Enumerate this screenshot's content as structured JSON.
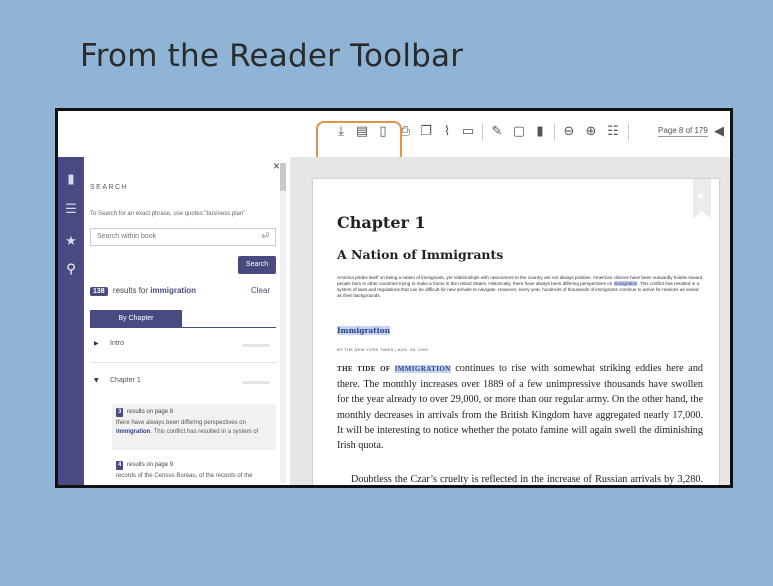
{
  "slide": {
    "title": "From the Reader Toolbar"
  },
  "toolbar": {
    "page_indicator": "Page 8 of 179",
    "icons": [
      "download-icon",
      "print-section-icon",
      "bookmark-outline-icon",
      "print-icon",
      "copy-icon",
      "link-icon",
      "comment-icon",
      "highlight-pen-icon",
      "note-icon",
      "bookmark-icon",
      "zoom-out-icon",
      "zoom-in-icon",
      "view-settings-icon",
      "previous-page-icon"
    ]
  },
  "rail": {
    "icons": [
      "book-icon",
      "table-of-contents-icon",
      "favorites-star-icon",
      "search-icon"
    ]
  },
  "search": {
    "close": "×",
    "heading": "SEARCH",
    "hint": "To Search for an exact phrase, use quotes:\"business plan\"",
    "placeholder": "Search within book",
    "enter_icon": "⏎",
    "search_button": "Search",
    "results_count": "138",
    "results_text": "results for",
    "results_term": "immigration",
    "clear": "Clear",
    "tab_label": "By Chapter",
    "chapters": [
      {
        "label": "Intro",
        "arrow": "▶",
        "progress": 0.15
      },
      {
        "label": "Chapter 1",
        "arrow": "▼",
        "progress": 0.9
      }
    ],
    "results": [
      {
        "count": "3",
        "page_text": "results on page 8",
        "snippet_pre": "there have always been differing perspectives on",
        "snippet_term": "immigration",
        "snippet_post": ". This conflict has resulted in a system of"
      },
      {
        "count": "4",
        "page_text": "results on page 9",
        "snippet_pre": "records of the Census Bureau, of the records of the",
        "snippet_term": "",
        "snippet_post": ""
      }
    ]
  },
  "document": {
    "chapter": "Chapter 1",
    "subtitle": "A Nation of Immigrants",
    "intro_pre": "America prides itself on being a nation of immigrants, yet relationships with newcomers to the country are not always positive. American citizens have been outwardly hostile toward people born in other countries trying to make a home in the United States. Historically, there have always been differing perspectives on",
    "intro_term": "immigration",
    "intro_post": ". This conflict has resulted in a system of laws and regulations that can be difficult for new arrivals to navigate. However, every year, hundreds of thousands of immigrants continue to arrive for reasons as varied as their backgrounds.",
    "section_head": "Immigration",
    "byline": "BY THE NEW YORK TIMES | AUG. 28, 1900",
    "para1_lead_a": "THE TIDE OF",
    "para1_lead_term": "IMMIGRATION",
    "para1": "continues to rise with somewhat striking eddies here and there. The monthly increases over 1889 of a few unimpressive thousands have swollen for the year already to over 29,000, or more than our regular army. On the other hand, the monthly decreases in arrivals from the British Kingdom have aggregated nearly 17,000. It will be interesting to notice whether the potato famine will again swell the diminishing Irish quota.",
    "para2": "Doubtless the Czar’s cruelty is reflected in the increase of Russian arrivals by 3,280. When he last attacked his Jews they flocked here by thousands, and a sorry lot they were."
  }
}
